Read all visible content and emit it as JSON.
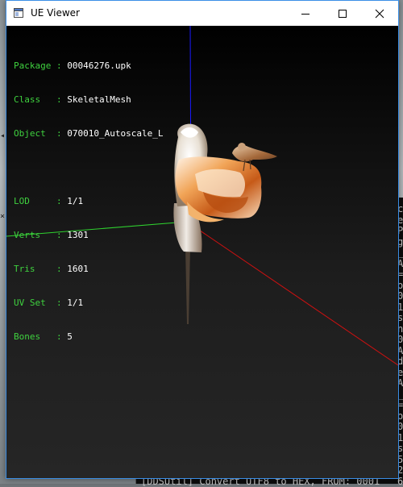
{
  "window": {
    "title": "UE Viewer"
  },
  "info": {
    "package": {
      "label": "Package",
      "value": "00046276.upk"
    },
    "class": {
      "label": "Class",
      "value": "SkeletalMesh"
    },
    "object": {
      "label": "Object",
      "value": "070010_Autoscale_L"
    },
    "lod": {
      "label": "LOD",
      "value": "1/1"
    },
    "verts": {
      "label": "Verts",
      "value": "1301"
    },
    "tris": {
      "label": "Tris",
      "value": "1601"
    },
    "uvset": {
      "label": "UV Set",
      "value": "1/1"
    },
    "bones": {
      "label": "Bones",
      "value": "5"
    }
  },
  "console": {
    "bottom_line": "[DDSUtil] Convert UTF8 to HEX, FROM: 0001",
    "right_column_chars": [
      "c",
      "e",
      "P",
      "g",
      "_",
      "A",
      "=",
      "o",
      "0",
      "1",
      "s",
      "n",
      "0",
      "A",
      "d",
      "e",
      "A",
      "_",
      "=",
      "o",
      "0",
      "1",
      "s",
      "5",
      "2",
      "6"
    ]
  },
  "colors": {
    "axis_x": "#d01010",
    "axis_y": "#2fd22f",
    "axis_z": "#1a1aff",
    "info_key": "#3fd23f",
    "info_value": "#ffffff",
    "titlebar_bg": "#ffffff",
    "accent_border": "#3a8ee6"
  },
  "icons": {
    "app": "window-app-icon",
    "minimize": "minimize-icon",
    "maximize": "maximize-icon",
    "close": "close-icon"
  }
}
